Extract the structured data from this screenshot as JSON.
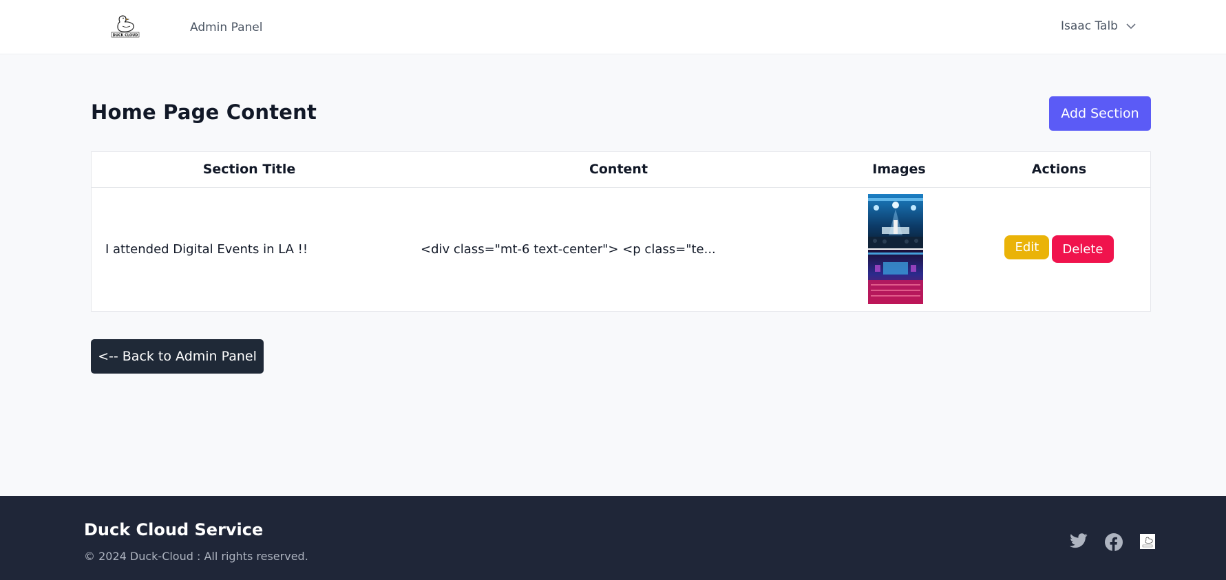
{
  "nav": {
    "admin_link": "Admin Panel",
    "user_name": "Isaac Talb",
    "logo_text": "DUCK CLOUD"
  },
  "page": {
    "title": "Home Page Content",
    "add_button": "Add Section",
    "back_button": "<-- Back to Admin Panel"
  },
  "table": {
    "headers": [
      "Section Title",
      "Content",
      "Images",
      "Actions"
    ],
    "rows": [
      {
        "title": "I attended Digital Events in LA !!",
        "content": "<div class=\"mt-6 text-center\"> <p class=\"te...",
        "images": [
          "concert-stage-photo",
          "event-hall-photo"
        ],
        "edit_label": "Edit",
        "delete_label": "Delete"
      }
    ]
  },
  "footer": {
    "title": "Duck Cloud Service",
    "copyright": "© 2024 Duck-Cloud : All rights reserved.",
    "social_icons": [
      "twitter-icon",
      "facebook-icon",
      "duck-cloud-icon"
    ]
  },
  "colors": {
    "primary": "#5b5bf6",
    "edit": "#eab308",
    "delete": "#f0134d",
    "dark": "#1f2937",
    "footer_bg": "#1f2638"
  }
}
